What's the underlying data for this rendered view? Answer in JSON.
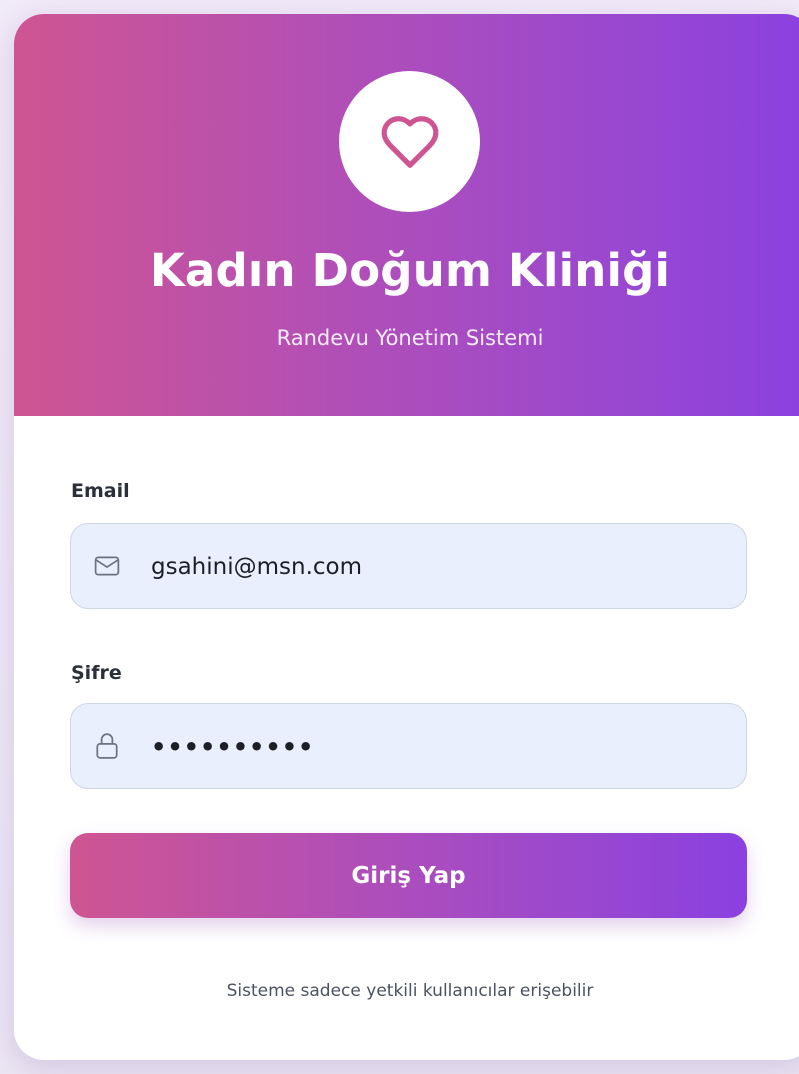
{
  "header": {
    "logo_icon": "heart-icon",
    "title": "Kadın Doğum Kliniği",
    "subtitle": "Randevu Yönetim Sistemi"
  },
  "form": {
    "email": {
      "label": "Email",
      "icon": "mail-icon",
      "value": "gsahini@msn.com"
    },
    "password": {
      "label": "Şifre",
      "icon": "lock-icon",
      "value": "••••••••••"
    },
    "submit_label": "Giriş Yap"
  },
  "footer": {
    "note": "Sisteme sadece yetkili kullanıcılar erişebilir"
  },
  "colors": {
    "gradient_start": "#cf5592",
    "gradient_end": "#8b40e0",
    "heart": "#cf5592",
    "field_background": "#e9effc"
  }
}
